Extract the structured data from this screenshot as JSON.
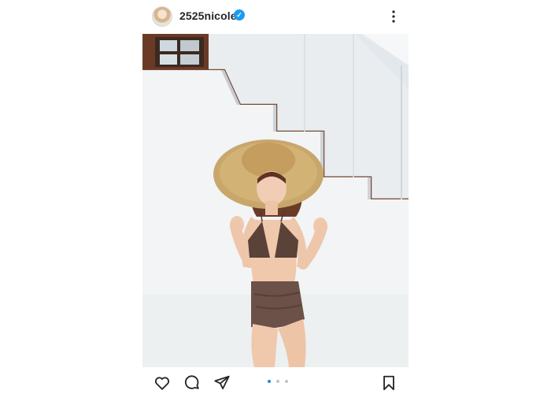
{
  "post": {
    "username": "2525nicole2",
    "verified": true,
    "avatar_icon": "profile-avatar",
    "more_icon": "more-vertical-icon"
  },
  "media": {
    "icon": "photo",
    "carousel_total": 3,
    "carousel_active": 1
  },
  "actions": {
    "like_icon": "heart-icon",
    "comment_icon": "comment-icon",
    "share_icon": "paper-plane-icon",
    "save_icon": "bookmark-icon"
  },
  "colors": {
    "verified_badge": "#1d9bf0",
    "carousel_active_dot": "#1e88e5",
    "carousel_inactive_dot": "#c4c4c4"
  }
}
